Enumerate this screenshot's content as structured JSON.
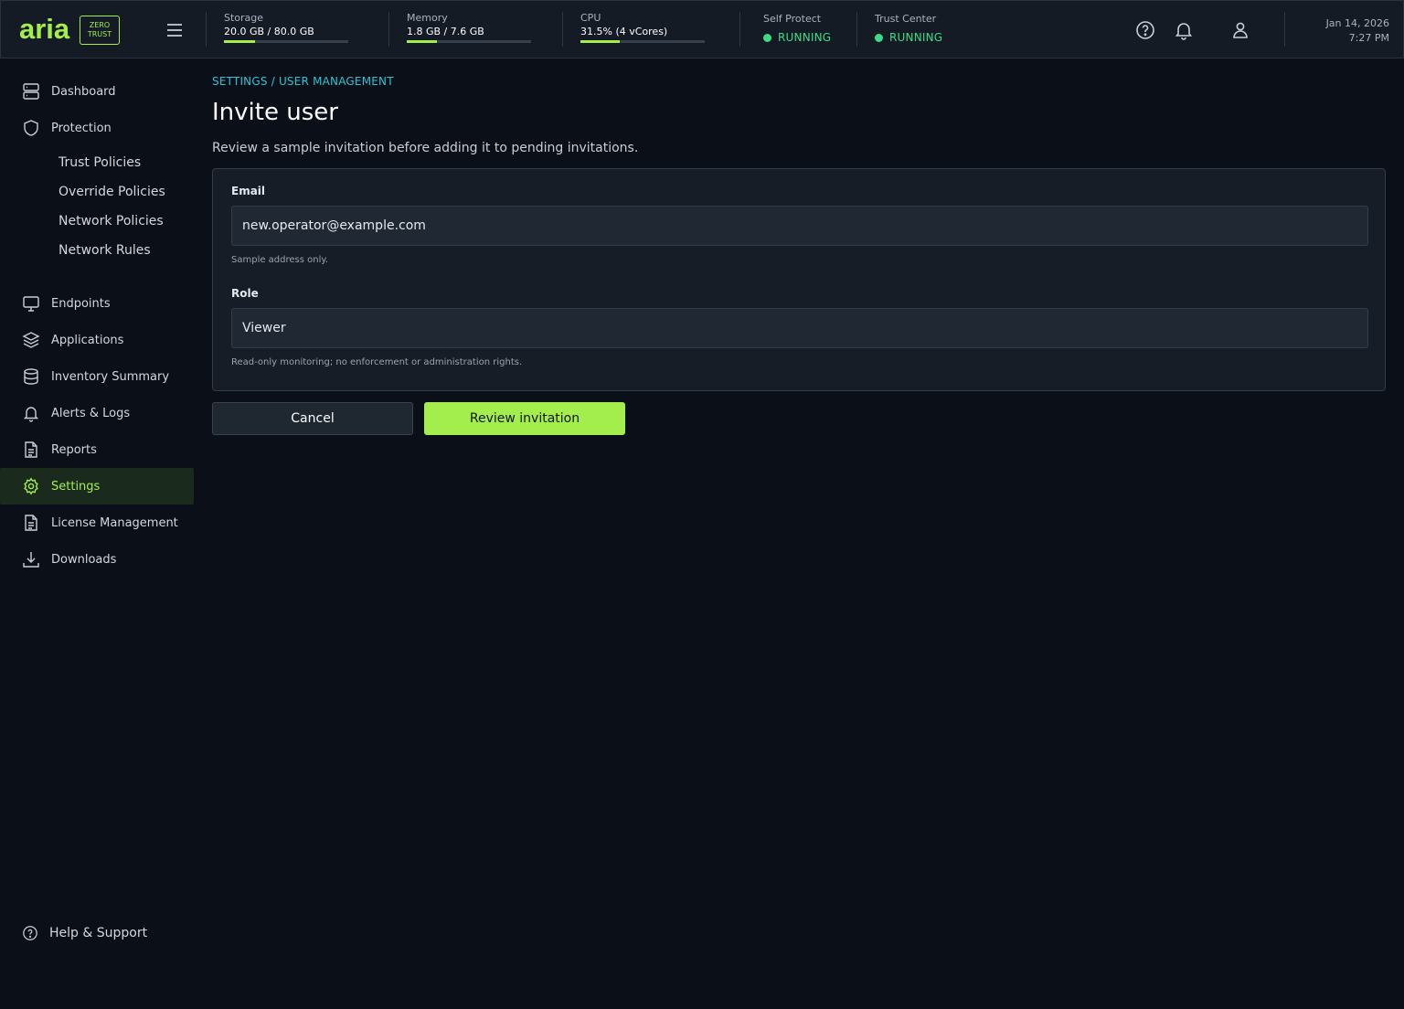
{
  "brand": {
    "logo_text": "aria",
    "badge_line1": "ZERO",
    "badge_line2": "TRUST",
    "accent_color": "#a3ee4c"
  },
  "header": {
    "metrics": [
      {
        "label": "Storage",
        "value": "20.0 GB / 80.0 GB",
        "fraction": 0.25
      },
      {
        "label": "Memory",
        "value": "1.8 GB / 7.6 GB",
        "fraction": 0.24
      },
      {
        "label": "CPU",
        "value": "31.5% (4 vCores)",
        "fraction": 0.315
      }
    ],
    "statuses": [
      {
        "label": "Self Protect",
        "value": "RUNNING",
        "color": "#3ddc84"
      },
      {
        "label": "Trust Center",
        "value": "RUNNING",
        "color": "#3ddc84"
      }
    ],
    "icons": [
      "menu-icon",
      "help-circle-icon",
      "bell-icon",
      "user-icon"
    ],
    "date": "Jan 14, 2026",
    "time": "7:27 PM"
  },
  "sidebar": {
    "items": [
      {
        "label": "Dashboard",
        "icon": "server-icon"
      },
      {
        "label": "Protection",
        "icon": "shield-icon"
      },
      {
        "label": "Endpoints",
        "icon": "monitor-icon"
      },
      {
        "label": "Applications",
        "icon": "layers-icon"
      },
      {
        "label": "Inventory Summary",
        "icon": "database-icon"
      },
      {
        "label": "Alerts & Logs",
        "icon": "bell-icon"
      },
      {
        "label": "Reports",
        "icon": "file-text-icon"
      },
      {
        "label": "Settings",
        "icon": "gear-icon",
        "active": true
      },
      {
        "label": "License Management",
        "icon": "file-text-icon"
      },
      {
        "label": "Downloads",
        "icon": "download-icon"
      }
    ],
    "sub_items": [
      "Trust Policies",
      "Override Policies",
      "Network Policies",
      "Network Rules"
    ],
    "help_label": "Help & Support"
  },
  "main": {
    "breadcrumb": "SETTINGS / USER MANAGEMENT",
    "title": "Invite user",
    "subtitle": "Review a sample invitation before adding it to pending invitations.",
    "form": {
      "email_label": "Email",
      "email_value": "new.operator@example.com",
      "email_help": "Sample address only.",
      "role_label": "Role",
      "role_value": "Viewer",
      "role_help": "Read-only monitoring; no enforcement or administration rights."
    },
    "cancel_label": "Cancel",
    "submit_label": "Review invitation"
  }
}
